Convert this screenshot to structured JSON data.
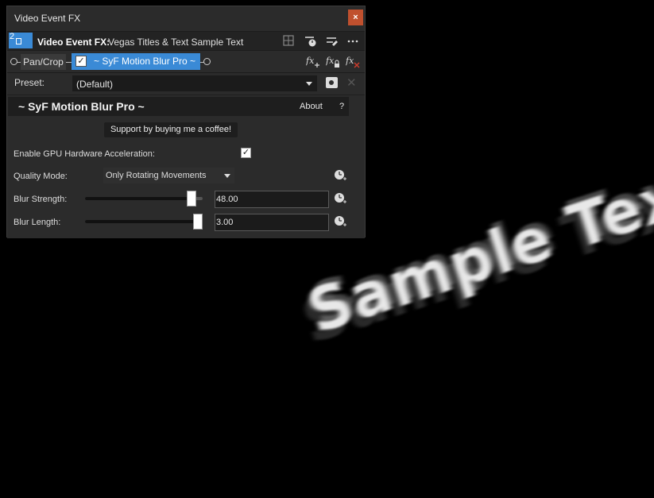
{
  "window": {
    "title": "Video Event FX",
    "close_label": "×"
  },
  "fx_header": {
    "event_number": "2",
    "label": "Video Event FX:",
    "value": "Vegas Titles & Text Sample Text"
  },
  "chain": {
    "pan_crop_label": "Pan/Crop",
    "plugin_label": "~ SyF Motion Blur Pro ~"
  },
  "preset": {
    "label": "Preset:",
    "value": "(Default)"
  },
  "plugin": {
    "title": "~ SyF Motion Blur Pro ~",
    "about_label": "About",
    "help_label": "?",
    "coffee_label": "Support by buying me a coffee!",
    "gpu_label": "Enable GPU Hardware Acceleration:",
    "gpu_checked": true,
    "quality_label": "Quality Mode:",
    "quality_value": "Only Rotating Movements",
    "blur_strength_label": "Blur Strength:",
    "blur_strength_value": "48.00",
    "blur_strength_level": 0.94,
    "blur_length_label": "Blur Length:",
    "blur_length_value": "3.00",
    "blur_length_level": 1.0
  },
  "preview": {
    "text": "Sample Text"
  },
  "colors": {
    "accent": "#3a8ad6",
    "close": "#c0502e",
    "panel": "#2b2b2b"
  },
  "icons": {
    "header": [
      "grid-icon",
      "keyframe-icon",
      "reorder-icon",
      "more-icon"
    ],
    "chain": [
      "fx-add-icon",
      "fx-lock-icon",
      "fx-remove-icon"
    ]
  }
}
